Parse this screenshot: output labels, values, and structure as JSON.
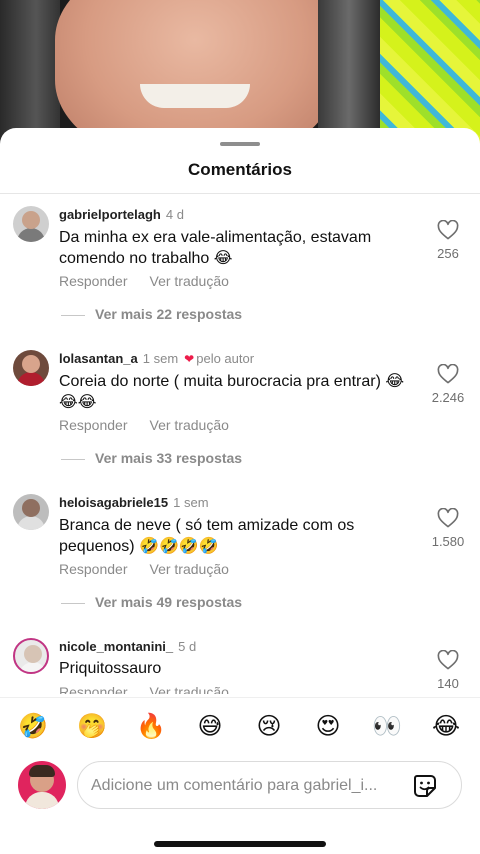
{
  "sheet": {
    "title": "Comentários"
  },
  "comments": [
    {
      "username": "gabrielportelagh",
      "time": "4 d",
      "author_like": "",
      "text": "Da minha ex era vale-alimentação, estavam comendo no trabalho 😂",
      "reply_label": "Responder",
      "translate_label": "Ver tradução",
      "view_replies": "Ver mais 22 respostas",
      "like_count": "256"
    },
    {
      "username": "lolasantan_a",
      "time": "1 sem",
      "author_like": "pelo autor",
      "text": "Coreia do norte ( muita burocracia pra entrar) 😂😂😂",
      "reply_label": "Responder",
      "translate_label": "Ver tradução",
      "view_replies": "Ver mais 33 respostas",
      "like_count": "2.246"
    },
    {
      "username": "heloisagabriele15",
      "time": "1 sem",
      "author_like": "",
      "text": "Branca de neve ( só tem amizade com os pequenos) 🤣🤣🤣🤣",
      "reply_label": "Responder",
      "translate_label": "Ver tradução",
      "view_replies": "Ver mais 49 respostas",
      "like_count": "1.580"
    },
    {
      "username": "nicole_montanini_",
      "time": "5 d",
      "author_like": "",
      "text": "Priquitossauro",
      "reply_label": "Responder",
      "translate_label": "Ver tradução",
      "view_replies": "",
      "like_count": "140"
    }
  ],
  "emoji_bar": [
    "🤣",
    "🤭",
    "🔥",
    "😅",
    "😢",
    "😍",
    "👀",
    "😂"
  ],
  "composer": {
    "placeholder": "Adicione um comentário para gabriel_i..."
  },
  "icons": {
    "like": "heart-outline-icon",
    "author_heart": "heart-filled-icon",
    "sticker": "sticker-icon"
  },
  "colors": {
    "author_heart": "#ed1c4a",
    "secondary_text": "#8a8a8a",
    "story_ring": "#c13584"
  }
}
